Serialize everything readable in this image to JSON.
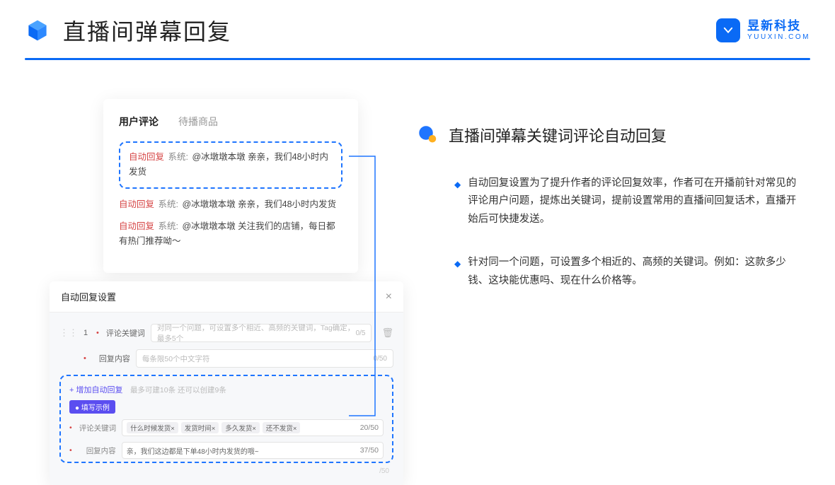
{
  "header": {
    "title": "直播间弹幕回复",
    "brand_name": "昱新科技",
    "brand_url": "YUUXIN.COM"
  },
  "comments": {
    "tabs": {
      "active": "用户评论",
      "idle": "待播商品"
    },
    "auto_tag": "自动回复",
    "sys_tag": "系统:",
    "row1": "@冰墩墩本墩 亲亲，我们48小时内发货",
    "row2": "@冰墩墩本墩 亲亲，我们48小时内发货",
    "row3": "@冰墩墩本墩 关注我们的店铺，每日都有热门推荐呦～"
  },
  "settings": {
    "title": "自动回复设置",
    "num": "1",
    "field1_label": "评论关键词",
    "field1_placeholder": "对同一个问题，可设置多个相近、高频的关键词，Tag确定，最多5个",
    "field1_counter": "0/5",
    "field2_label": "回复内容",
    "field2_placeholder": "每条限50个中文字符",
    "field2_counter": "0/50",
    "add_link": "+ 增加自动回复",
    "add_note": "最多可建10条 还可以创建9条",
    "example_tag": "● 填写示例",
    "ex_field1_label": "评论关键词",
    "ex_chips": [
      "什么时候发货×",
      "发货时间×",
      "多久发货×",
      "还不发货×"
    ],
    "ex_field1_counter": "20/50",
    "ex_field2_label": "回复内容",
    "ex_field2_value": "亲，我们这边都是下单48小时内发货的哦~",
    "ex_field2_counter": "37/50",
    "hidden_counter": "/50"
  },
  "right": {
    "heading": "直播间弹幕关键词评论自动回复",
    "bullet1": "自动回复设置为了提升作者的评论回复效率，作者可在开播前针对常见的评论用户问题，提炼出关键词，提前设置常用的直播间回复话术，直播开始后可快捷发送。",
    "bullet2": "针对同一个问题，可设置多个相近的、高频的关键词。例如：这款多少钱、这块能优惠吗、现在什么价格等。"
  }
}
